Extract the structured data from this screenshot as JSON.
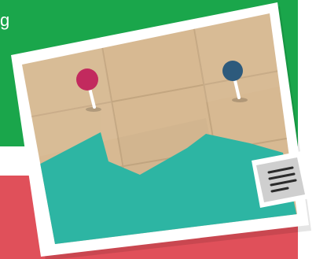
{
  "hero": {
    "tagline": "            herever you're\n   g"
  },
  "colors": {
    "green_panel": "#1aa64b",
    "red_panel": "#e0505a",
    "map_paper": "#d7b992",
    "sea": "#2db5a3",
    "pin_magenta": "#c22a5e",
    "pin_navy": "#2d5a7c",
    "stamp": "#cfcfcf"
  },
  "illustration": {
    "name": "postcard-with-map",
    "pins": [
      "pin-magenta",
      "pin-navy"
    ],
    "stamp_icon": "text-lines-icon"
  }
}
